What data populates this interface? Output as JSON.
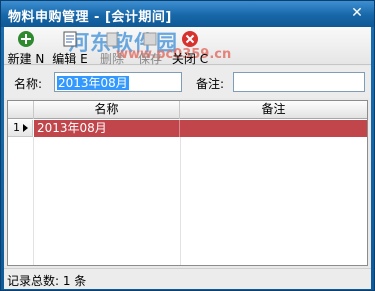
{
  "window": {
    "title": "物料申购管理 - [会计期间]",
    "close_glyph": "✕"
  },
  "watermark": {
    "text": "河东软件园",
    "url": "www.pc0359.cn"
  },
  "toolbar": {
    "buttons": [
      {
        "id": "new",
        "label": "新建 N",
        "icon": "add-icon",
        "enabled": true
      },
      {
        "id": "edit",
        "label": "编辑 E",
        "icon": "edit-icon",
        "enabled": true
      },
      {
        "id": "delete",
        "label": "删除",
        "icon": "delete-icon",
        "enabled": false
      },
      {
        "id": "save",
        "label": "保存",
        "icon": "save-icon",
        "enabled": false
      },
      {
        "id": "close",
        "label": "关闭 C",
        "icon": "close-icon",
        "enabled": true
      }
    ]
  },
  "search": {
    "name_label": "名称:",
    "name_value": "2013年08月",
    "note_label": "备注:",
    "note_value": ""
  },
  "grid": {
    "columns": [
      "名称",
      "备注"
    ],
    "rows": [
      {
        "index": "1",
        "name": "2013年08月",
        "note": ""
      }
    ],
    "selected_row_color": "#c0464c"
  },
  "status": {
    "text": "记录总数: 1 条"
  }
}
